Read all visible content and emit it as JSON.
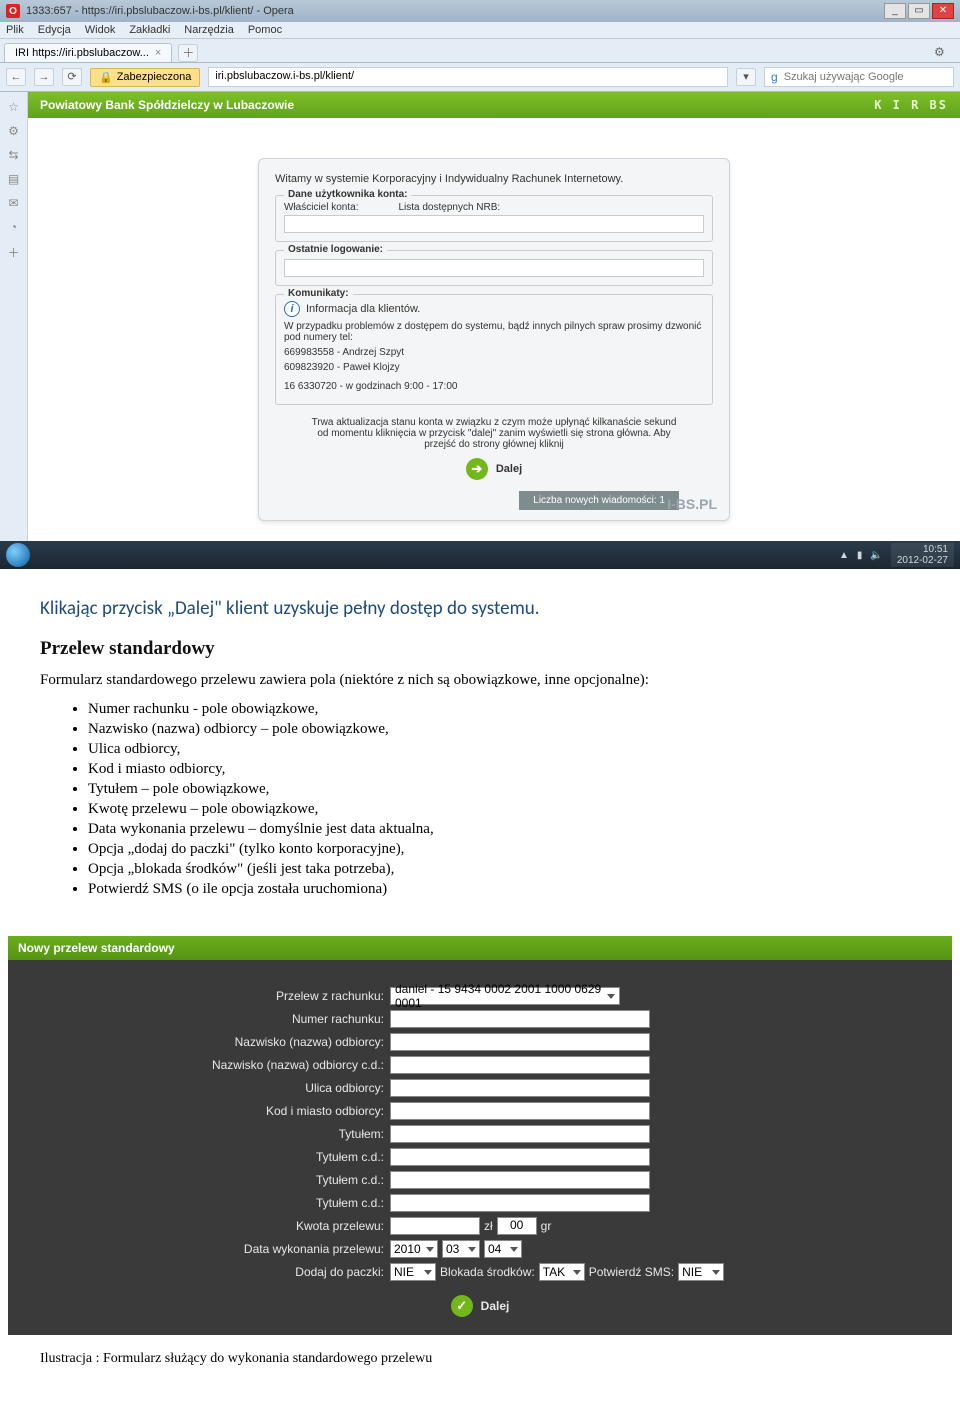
{
  "browser": {
    "window_title": "1333:657 - https://iri.pbslubaczow.i-bs.pl/klient/ - Opera",
    "menu": {
      "plik": "Plik",
      "edycja": "Edycja",
      "widok": "Widok",
      "zakladki": "Zakładki",
      "narzedzia": "Narzędzia",
      "pomoc": "Pomoc"
    },
    "tab_label": "IRI https://iri.pbslubaczow...",
    "security_label": "Zabezpieczona",
    "address": "iri.pbslubaczow.i-bs.pl/klient/",
    "search_placeholder": "Szukaj używając Google"
  },
  "bank_header": {
    "title": "Powiatowy Bank Spółdzielczy w Lubaczowie",
    "logos": "K I R BS"
  },
  "dialog": {
    "intro": "Witamy w systemie Korporacyjny i Indywidualny Rachunek Internetowy.",
    "fs_user_legend": "Dane użytkownika konta:",
    "owner_lbl": "Właściciel konta:",
    "nrb_lbl": "Lista dostępnych NRB:",
    "fs_login_legend": "Ostatnie logowanie:",
    "fs_msgs_legend": "Komunikaty:",
    "clients_info": "Informacja dla klientów.",
    "msg1": "W przypadku problemów z dostępem do systemu, bądź innych pilnych spraw prosimy dzwonić pod numery tel:",
    "msg2": "669983558 - Andrzej Szpyt",
    "msg3": "609823920 - Paweł Klojzy",
    "msg4": "16 6330720 - w godzinach 9:00 - 17:00",
    "wait_txt": "Trwa aktualizacja stanu konta w związku z czym może upłynąć kilkanaście sekund od momentu kliknięcia w przycisk \"dalej\" zanim wyświetli się strona główna. Aby przejść do strony głównej kliknij",
    "dalej": "Dalej",
    "msg_bar": "Liczba nowych wiadomości: 1",
    "ibs": "I-BS.PL"
  },
  "taskbar": {
    "time": "10:51",
    "date": "2012-02-27"
  },
  "doc": {
    "h1": "Klikając przycisk „Dalej\" klient uzyskuje pełny dostęp do systemu.",
    "h2": "Przelew standardowy",
    "p1": "Formularz standardowego przelewu zawiera pola (niektóre z nich są obowiązkowe, inne opcjonalne):",
    "li": {
      "0": "Numer rachunku - pole obowiązkowe,",
      "1": "Nazwisko (nazwa) odbiorcy – pole obowiązkowe,",
      "2": "Ulica odbiorcy,",
      "3": "Kod i miasto odbiorcy,",
      "4": "Tytułem – pole obowiązkowe,",
      "5": "Kwotę przelewu – pole obowiązkowe,",
      "6": "Data wykonania przelewu – domyślnie jest data aktualna,",
      "7": "Opcja „dodaj do paczki\" (tylko konto korporacyjne),",
      "8": "Opcja „blokada środków\" (jeśli jest taka potrzeba),",
      "9": "Potwierdź SMS (o ile opcja została uruchomiona)"
    }
  },
  "form": {
    "header": "Nowy przelew standardowy",
    "labels": {
      "przelew_z": "Przelew z rachunku:",
      "numer": "Numer rachunku:",
      "nazwisko": "Nazwisko (nazwa) odbiorcy:",
      "nazwisko_cd": "Nazwisko (nazwa) odbiorcy c.d.:",
      "ulica": "Ulica odbiorcy:",
      "kod": "Kod i miasto odbiorcy:",
      "tytul": "Tytułem:",
      "tytul_cd": "Tytułem c.d.:",
      "kwota": "Kwota przelewu:",
      "zl": "zł",
      "gr_val": "00",
      "gr": "gr",
      "data": "Data wykonania przelewu:",
      "year": "2010",
      "month": "03",
      "day": "04",
      "dodaj": "Dodaj do paczki:",
      "blokada": "Blokada środków:",
      "potw": "Potwierdź SMS:",
      "nie": "NIE",
      "tak": "TAK",
      "dalej": "Dalej"
    },
    "account_sel": "daniel - 15 9434 0002 2001 1000 0629 0001"
  },
  "illus": "Ilustracja : Formularz służący do wykonania standardowego przelewu"
}
